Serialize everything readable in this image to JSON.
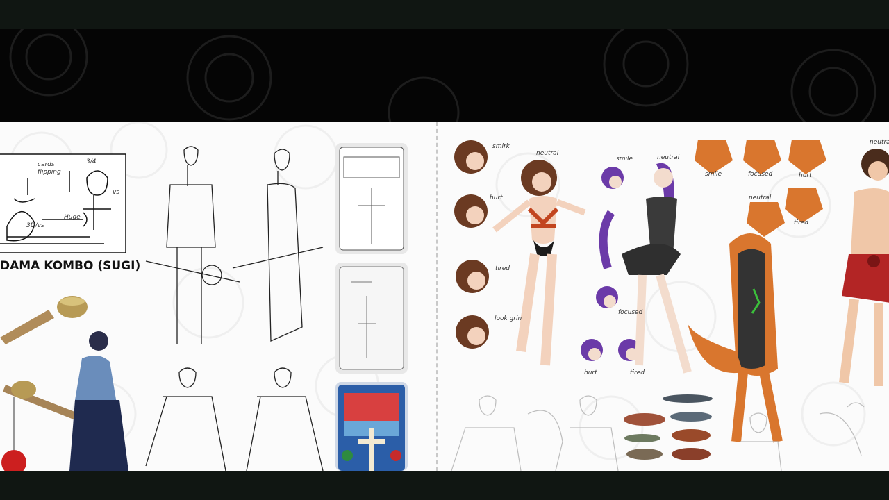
{
  "labels": {
    "title": "DAMA KOMBO (SUGI)",
    "sketch_notes": [
      "cards",
      "flipping",
      "3D/vs",
      "Huge",
      "3/4",
      "vs"
    ]
  },
  "expression_notes": {
    "girl": [
      "smirk",
      "neutral",
      "hurt",
      "tired",
      "look grin"
    ],
    "purple": [
      "smile",
      "neutral",
      "focused",
      "hurt",
      "tired"
    ],
    "fox": [
      "smile",
      "focused",
      "hurt",
      "neutral",
      "tired"
    ],
    "man": [
      "neutral"
    ]
  },
  "colors": {
    "header_bg": "#050505",
    "bar_bg": "#101612",
    "board_bg": "#fbfbfb",
    "accent_red": "#cc1f1f",
    "fox_orange": "#d9762e",
    "purple_hair": "#6b3aa8",
    "brown_hair": "#6b3a22"
  }
}
